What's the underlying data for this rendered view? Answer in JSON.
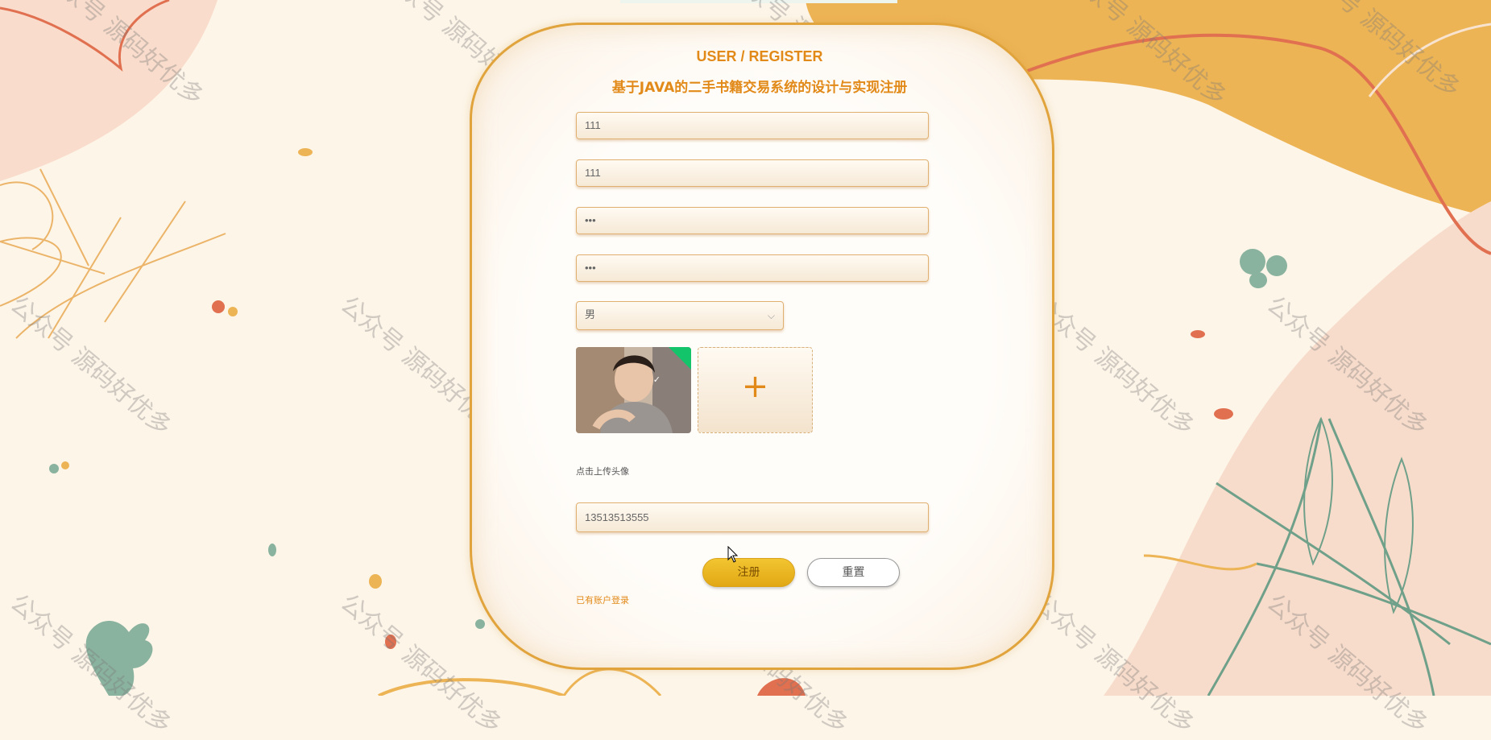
{
  "form": {
    "title": "USER / REGISTER",
    "subtitle": "基于JAVA的二手书籍交易系统的设计与实现注册",
    "account_value": "111",
    "name_value": "111",
    "password_value": "•••",
    "confirm_password_value": "•••",
    "gender_value": "男",
    "upload_hint": "点击上传头像",
    "phone_value": "13513513555",
    "register_label": "注册",
    "reset_label": "重置",
    "login_link": "已有账户登录"
  },
  "watermark": "公众号 源码好优多",
  "colors": {
    "accent": "#e28a19",
    "button_gold": "#f2c531",
    "background": "#fdf5e8"
  },
  "icons": {
    "chevron": "chevron-down-icon",
    "upload": "plus-icon",
    "check": "check-icon",
    "cursor": "mouse-cursor-icon"
  }
}
